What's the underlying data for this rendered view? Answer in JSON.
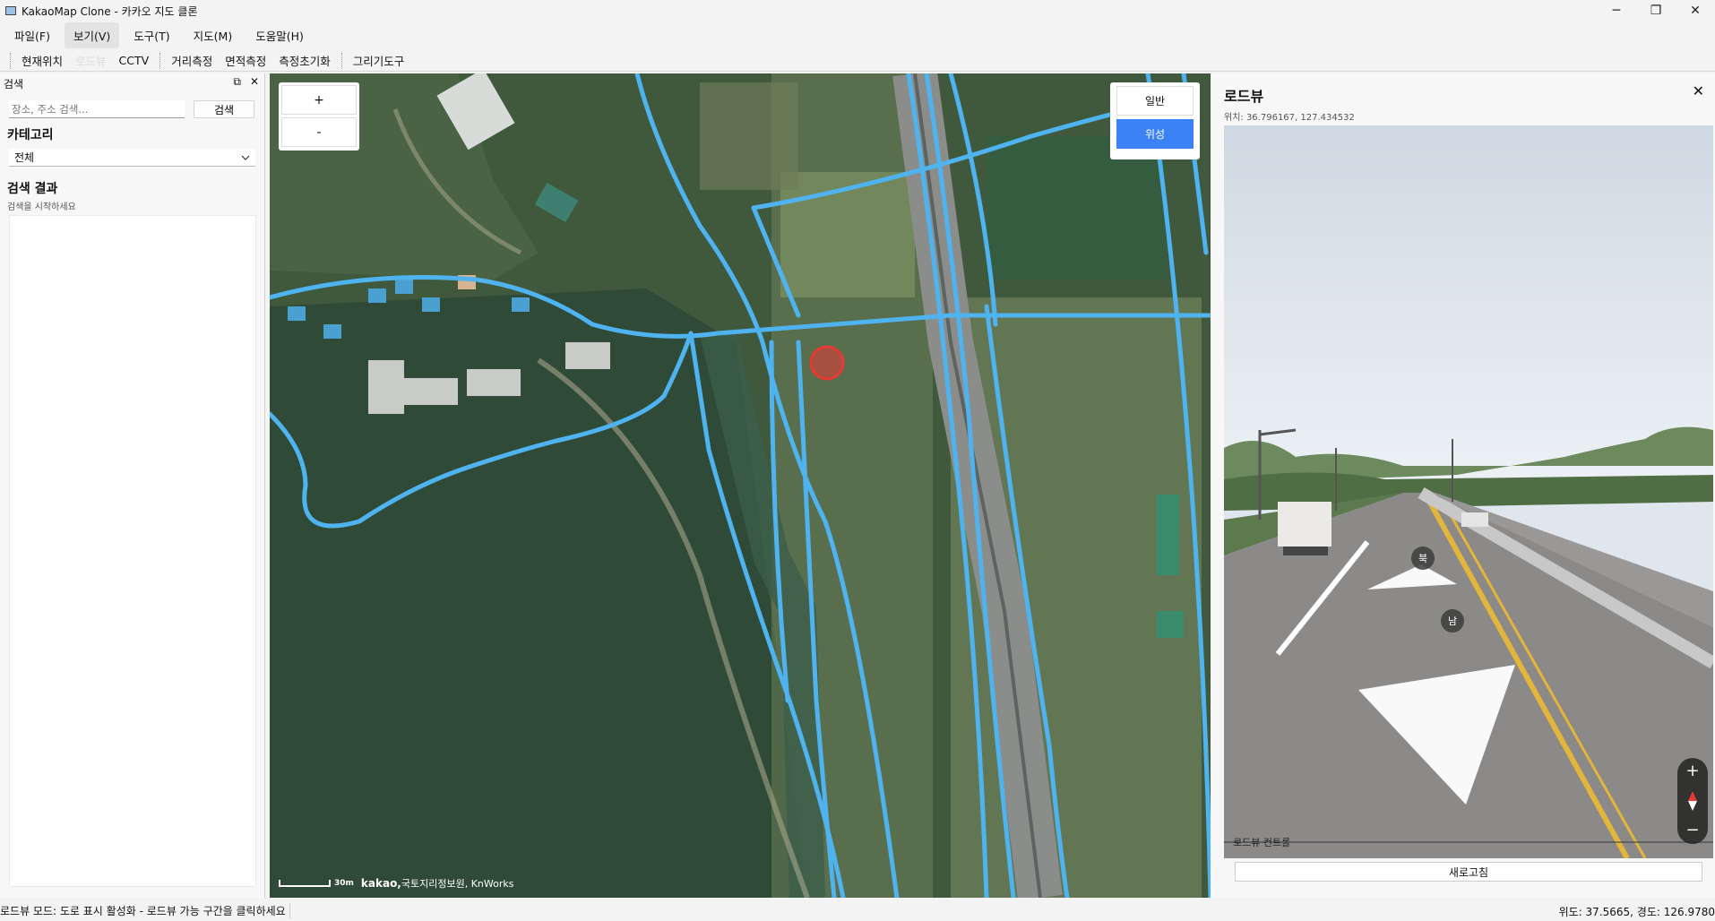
{
  "window": {
    "title": "KakaoMap Clone - 카카오 지도 클론",
    "minimize": "─",
    "maximize": "❐",
    "close": "✕"
  },
  "menu": [
    "파일(F)",
    "보기(V)",
    "도구(T)",
    "지도(M)",
    "도움말(H)"
  ],
  "toolbar": {
    "current_location": "현재위치",
    "roadview": "로드뷰",
    "cctv": "CCTV",
    "distance": "거리측정",
    "area": "면적측정",
    "reset_measure": "측정초기화",
    "draw_tool": "그리기도구"
  },
  "dock": {
    "title": "검색",
    "float_icon": "⧉",
    "close_icon": "✕",
    "search_placeholder": "장소, 주소 검색...",
    "search_button": "검색",
    "category_label": "카테고리",
    "category_value": "전체",
    "results_label": "검색 결과",
    "results_hint": "검색을 시작하세요"
  },
  "map": {
    "zoom_in": "+",
    "zoom_out": "-",
    "type_normal": "일반",
    "type_satellite": "위성",
    "scale": "30m",
    "credit_brand": "kakao,",
    "credit_rest": " 국토지리정보원, KnWorks"
  },
  "roadview": {
    "title": "로드뷰",
    "close": "✕",
    "position": "위치: 36.796167, 127.434532",
    "dir_north": "북",
    "dir_south": "남",
    "control_label": "로드뷰 컨트롤",
    "zoom_in": "+",
    "zoom_out": "−",
    "refresh": "새로고침"
  },
  "status": {
    "message": "로드뷰 모드: 도로 표시 활성화 - 로드뷰 가능 구간을 클릭하세요",
    "coords": "위도: 37.5665, 경도: 126.9780"
  },
  "colors": {
    "road_overlay": "#4fb3f0",
    "selected_maptype": "#3b82f6",
    "marker": "#e53935"
  }
}
